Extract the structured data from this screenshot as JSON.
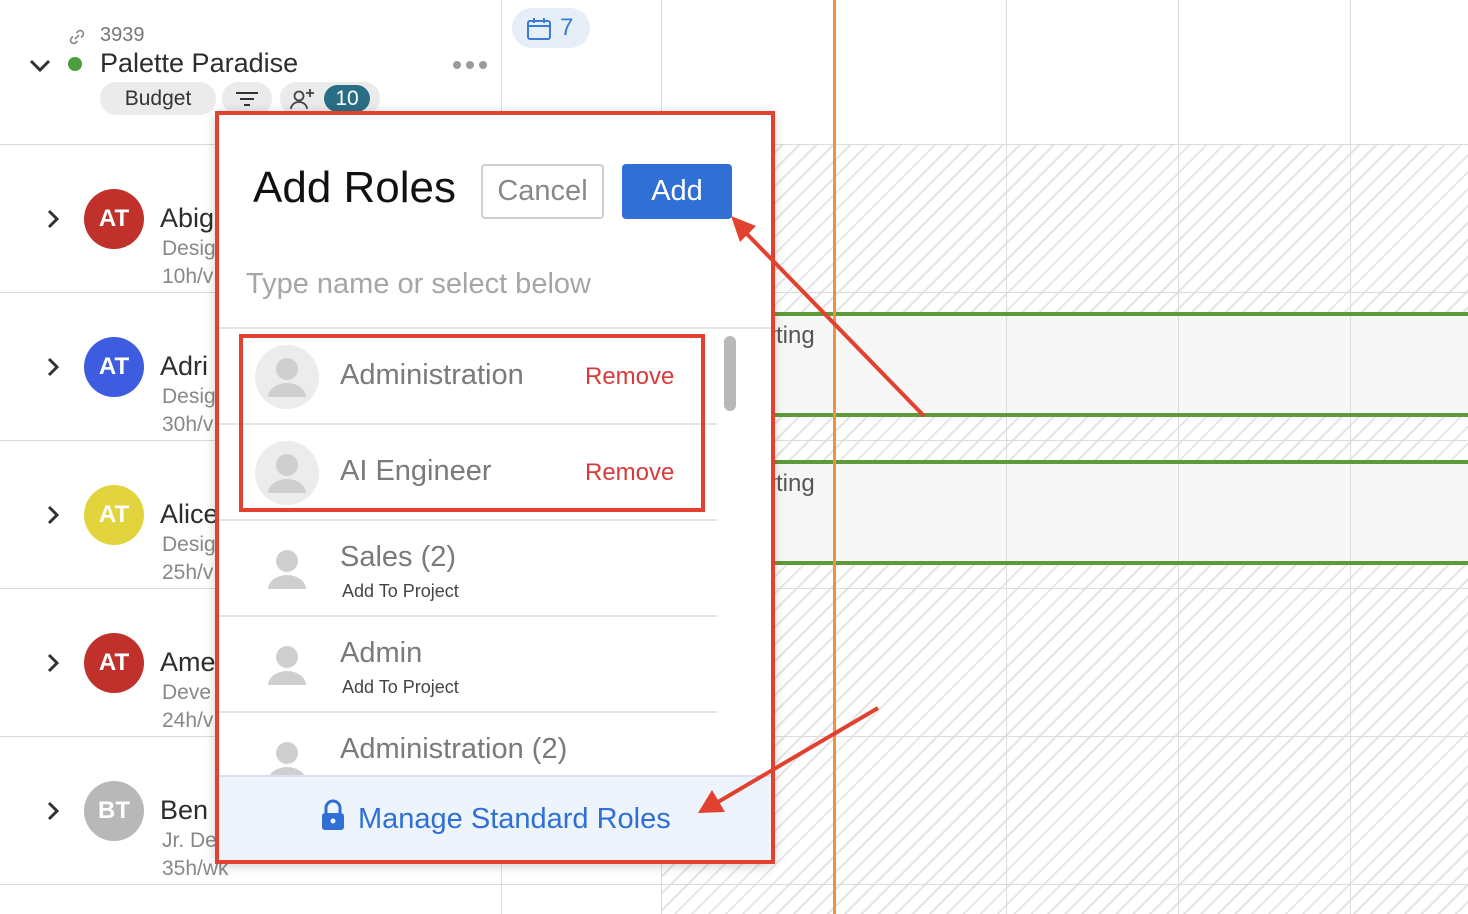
{
  "project": {
    "id": "3939",
    "title": "Palette Paradise",
    "budget_label": "Budget",
    "member_count": "10",
    "status_color": "#4a9e3c"
  },
  "members": [
    {
      "initials": "AT",
      "name": "Abig",
      "role": "Desig",
      "hours": "10h/v",
      "avatar_color": "#c0312b"
    },
    {
      "initials": "AT",
      "name": "Adri",
      "role": "Desig",
      "hours": "30h/v",
      "avatar_color": "#3e5ce0"
    },
    {
      "initials": "AT",
      "name": "Alice",
      "role": "Desig",
      "hours": "25h/v",
      "avatar_color": "#e2d43c"
    },
    {
      "initials": "AT",
      "name": "Ame",
      "role": "Deve",
      "hours": "24h/v",
      "avatar_color": "#c0312b"
    },
    {
      "initials": "BT",
      "name": "Ben",
      "role": "Jr. De",
      "hours": "35h/wk",
      "avatar_color": "#b8b8b8"
    }
  ],
  "schedule": {
    "date_chip": "7",
    "bar_labels": [
      "rting",
      "rting"
    ],
    "today_color": "#f0913f",
    "bar_color": "#5e9a3a"
  },
  "modal": {
    "title": "Add Roles",
    "cancel_label": "Cancel",
    "add_label": "Add",
    "search_placeholder": "Type name or select below",
    "search_value": "",
    "selected_roles": [
      {
        "name": "Administration",
        "action": "Remove"
      },
      {
        "name": "AI Engineer",
        "action": "Remove"
      }
    ],
    "available_roles": [
      {
        "name": "Sales (2)",
        "action": "Add To Project"
      },
      {
        "name": "Admin",
        "action": "Add To Project"
      },
      {
        "name": "Administration (2)",
        "action": ""
      }
    ],
    "manage_label": "Manage Standard Roles",
    "accent_color": "#2f6fd6",
    "remove_color": "#d83a3a",
    "annotation_color": "#e2412f"
  }
}
